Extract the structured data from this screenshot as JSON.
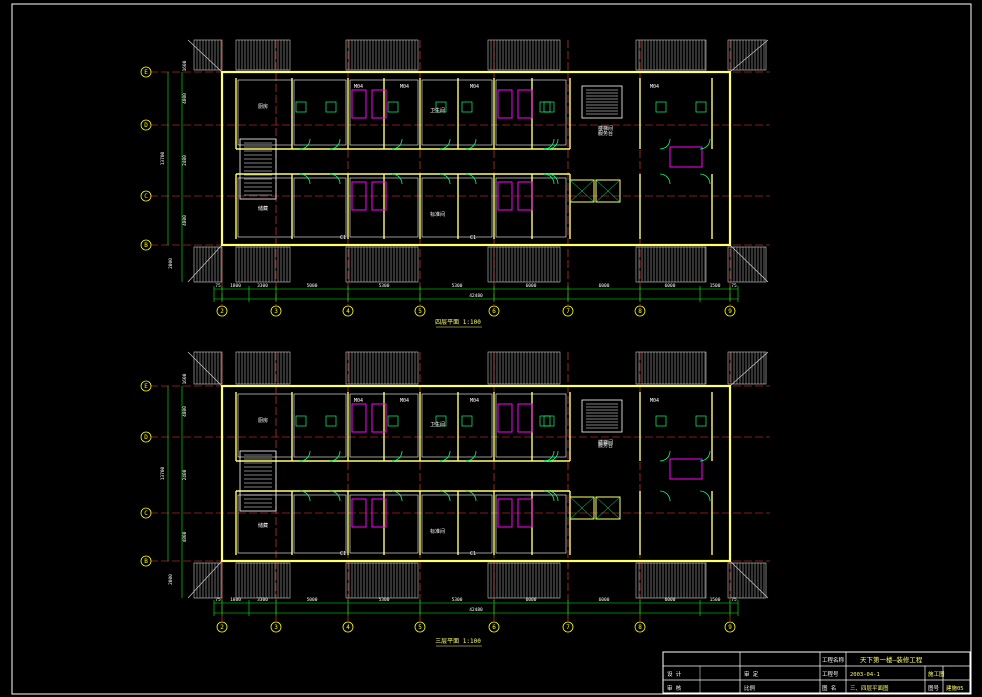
{
  "drawing": {
    "colors": {
      "background": "#000000",
      "wall": "#ffff66",
      "room": "#ffffff",
      "dim": "#00ff00",
      "axis": "#ff3b3b",
      "axis_bubble": "#ffff00",
      "door": "#00ff7f",
      "fixture": "#ff00ff",
      "text": "#ffffff",
      "roof": "#cfcfcf",
      "label_text": "#ffff66"
    },
    "plans": [
      {
        "id": "upper",
        "caption": "四层平面 1:100",
        "rows": [
          {
            "name": "E",
            "dim": "1600"
          },
          {
            "name": "D",
            "dim": "4800"
          },
          {
            "name": "C",
            "dim": "2400"
          },
          {
            "name": "B",
            "dim": "4800"
          }
        ],
        "overall_v": "13700",
        "bottom_v": "2000"
      },
      {
        "id": "lower",
        "caption": "三层平面 1:100",
        "rows": [
          {
            "name": "E",
            "dim": "1600"
          },
          {
            "name": "D",
            "dim": "4800"
          },
          {
            "name": "C",
            "dim": "2400"
          },
          {
            "name": "B",
            "dim": "4800"
          }
        ],
        "overall_v": "13700",
        "bottom_v": "2000"
      }
    ],
    "columns": [
      "2",
      "3",
      "4",
      "5",
      "6",
      "7",
      "8",
      "9"
    ],
    "column_dims": [
      "75",
      "1800",
      "3300",
      "5000",
      "5300",
      "5300",
      "6000",
      "6000",
      "6000",
      "1500",
      "75"
    ],
    "overall_h": "42480",
    "room_labels": [
      "厨房",
      "储藏",
      "卫生间",
      "楼梯间",
      "服务台",
      "标准间",
      "M04",
      "M04",
      "M04",
      "M04",
      "C1",
      "C1"
    ],
    "title_block": {
      "company": "工程名称",
      "project": "天下第一楼—装修工程",
      "drawing_no_label": "工程号",
      "drawing_no": "2003-04-1",
      "sheet_label": "图 名",
      "sheet_title": "三、四层平面图",
      "drawn_label": "设 计",
      "check_label": "审 核",
      "approve_label": "审 定",
      "stage_label": "图号",
      "stage": "施工图",
      "page": "建施05",
      "scale_label": "比例"
    }
  }
}
